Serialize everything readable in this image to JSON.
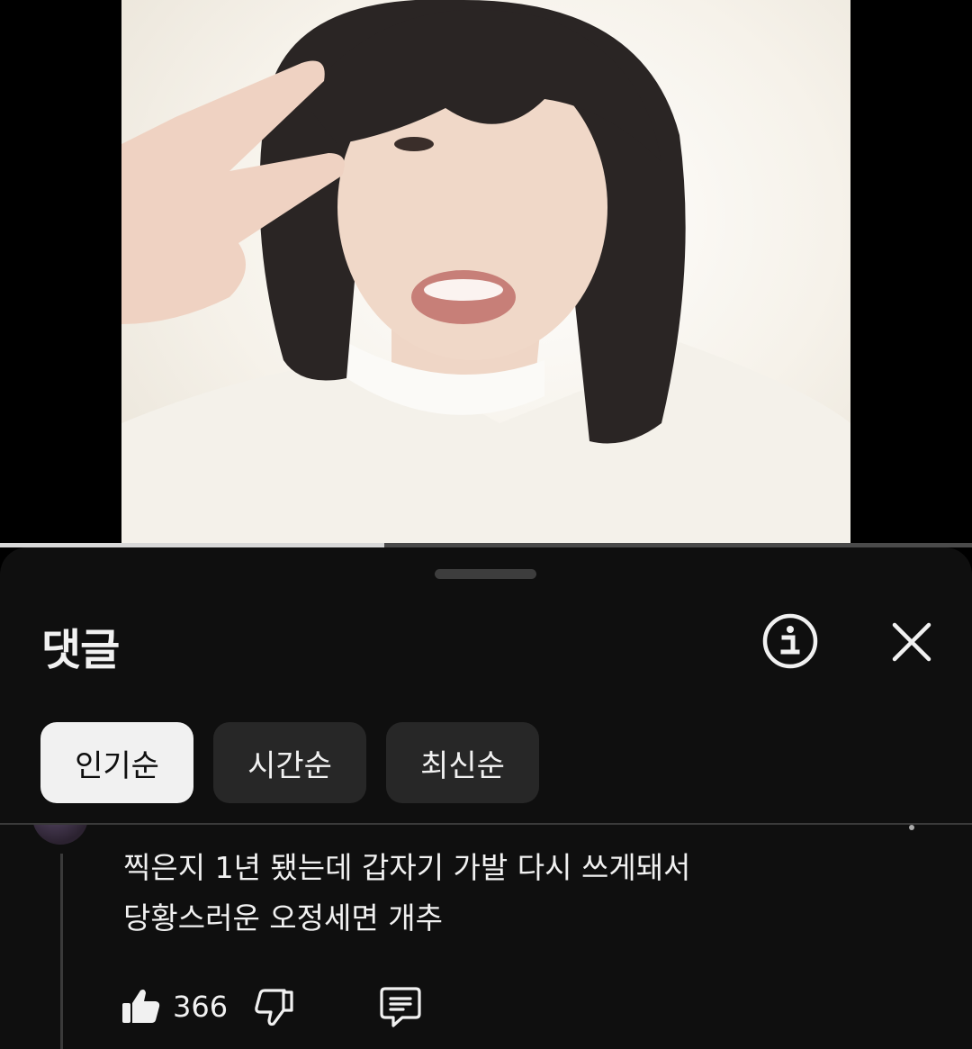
{
  "video": {
    "progress_fraction": 0.395
  },
  "comments_sheet": {
    "title": "댓글",
    "info_icon": "info-icon",
    "close_icon": "close-icon",
    "sort_chips": [
      {
        "label": "인기순",
        "selected": true
      },
      {
        "label": "시간순",
        "selected": false
      },
      {
        "label": "최신순",
        "selected": false
      }
    ]
  },
  "comment": {
    "lines": [
      "찍은지 1년 됐는데 갑자기 가발 다시 쓰게돼서",
      "당황스러운 오정세면 개추"
    ],
    "like_count": "366",
    "like_icon": "thumbs-up-icon",
    "dislike_icon": "thumbs-down-icon",
    "reply_icon": "reply-comment-icon"
  },
  "colors": {
    "sheet_background": "#0f0f0f",
    "chip_active_background": "#f1f1f1",
    "chip_background": "#272727",
    "text_primary": "#f1f1f1"
  }
}
